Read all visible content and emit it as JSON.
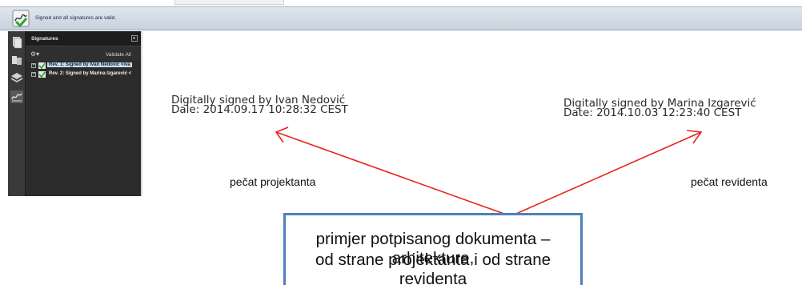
{
  "signature_bar": {
    "message": "Signed and all signatures are valid.",
    "icon": "signature-valid-icon"
  },
  "nav_rail": {
    "icons": [
      "pages-icon",
      "attachments-icon",
      "layers-icon",
      "signature-panel-icon"
    ]
  },
  "signatures_panel": {
    "title": "Signatures",
    "options_glyph": "⚙▾",
    "validate_all": "Validate All",
    "items": [
      {
        "label": "Rev. 1: Signed by Ivan Nedović <iva",
        "selected": true
      },
      {
        "label": "Rev. 2: Signed by Marina Izgarević <",
        "selected": false
      }
    ]
  },
  "document": {
    "signature_1": {
      "line1": "Digitally signed by Ivan Nedović",
      "line2": "Dale: 2014.09.17 10:28:32 CEST"
    },
    "signature_2": {
      "line1": "Digitally signed by Marina Izgarević",
      "line2": "Date: 2014.10.03 12:23:40 CEST"
    },
    "seal_1": "pečat projektanta",
    "seal_2": "pečat revidenta"
  },
  "callout": {
    "line1": "primjer potpisanog dokumenta – arhitekture,",
    "line2": "od strane projektanta i od strane revidenta",
    "border_color": "#4f81bd"
  },
  "arrow_color": "#e8251f"
}
